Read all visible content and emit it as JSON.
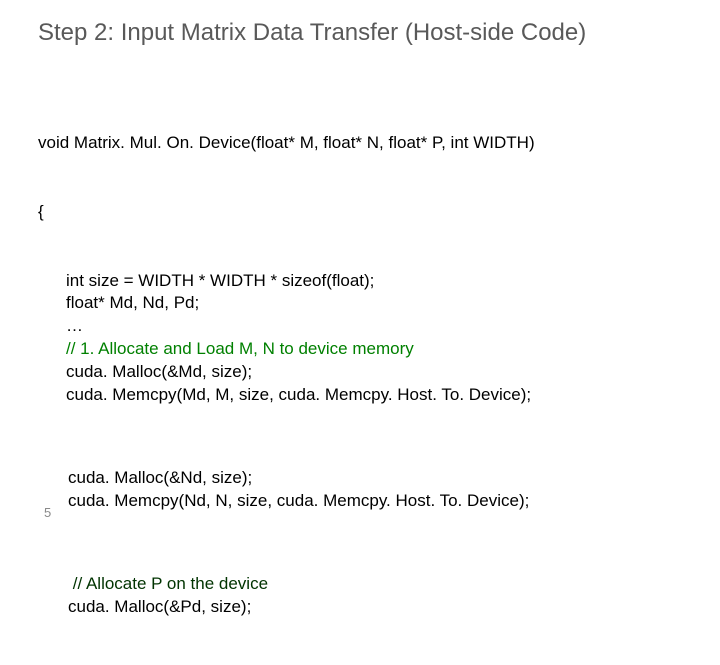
{
  "title": "Step 2: Input Matrix Data Transfer (Host-side Code)",
  "code": {
    "sig": "void Matrix. Mul. On. Device(float* M, float* N, float* P, int WIDTH)",
    "open": "{",
    "l1": "int size = WIDTH * WIDTH * sizeof(float);",
    "l2": "float* Md, Nd, Pd;",
    "l3": "…",
    "c1": "// 1. Allocate and Load M, N to device memory",
    "l4": "cuda. Malloc(&Md, size);",
    "l5": "cuda. Memcpy(Md, M, size, cuda. Memcpy. Host. To. Device);",
    "l6": "cuda. Malloc(&Nd, size);",
    "l7": "cuda. Memcpy(Nd, N, size, cuda. Memcpy. Host. To. Device);",
    "c2": " // Allocate P on the device",
    "l8": "cuda. Malloc(&Pd, size);"
  },
  "page_number": "5"
}
